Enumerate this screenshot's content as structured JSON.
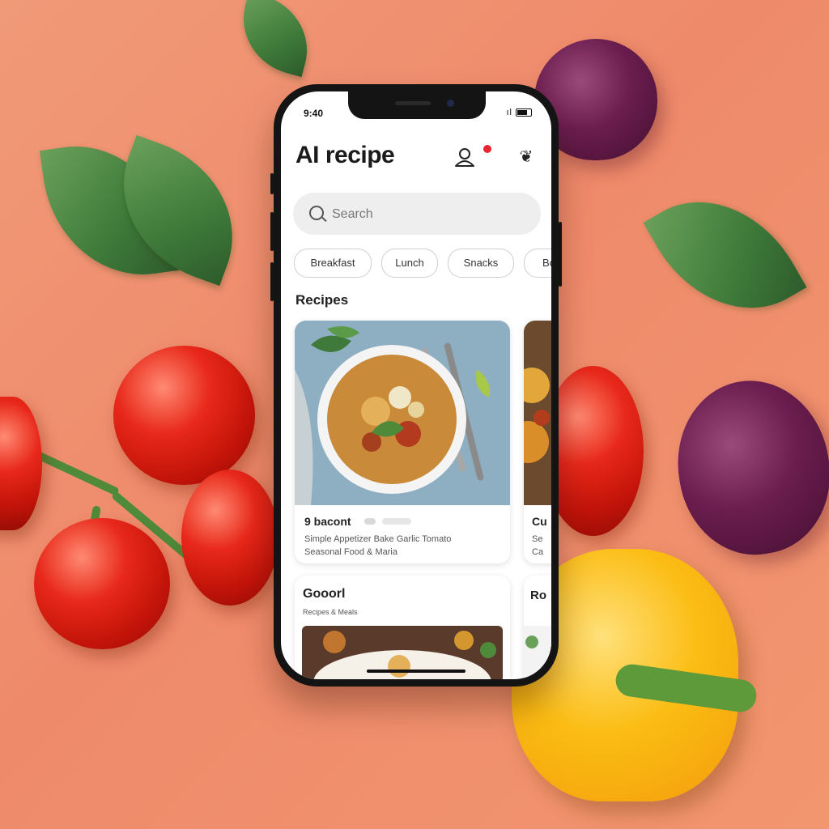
{
  "status_bar": {
    "time": "9:40",
    "signal": "ıl"
  },
  "header": {
    "title": "AI recipe",
    "settings_glyph": "❦"
  },
  "search": {
    "placeholder": "Search"
  },
  "categories": [
    {
      "label": "Breakfast"
    },
    {
      "label": "Lunch"
    },
    {
      "label": "Snacks"
    },
    {
      "label": "Bo"
    }
  ],
  "section": {
    "title": "Recipes"
  },
  "cards": [
    {
      "title": "9 bacont",
      "line1": "Simple Appetizer   Bake Garlic Tomato",
      "line2": "Seasonal   Food & Maria"
    },
    {
      "title": "Cu",
      "line1": "Se",
      "line2": "Ca"
    },
    {
      "title": "Gooorl",
      "meta": "Recipes & Meals"
    },
    {
      "title": "Ro"
    }
  ],
  "colors": {
    "accent": "#e8262d",
    "background": "#ef8f6c"
  },
  "icons": [
    "search-icon",
    "profile-icon",
    "notification-dot",
    "settings-icon"
  ]
}
